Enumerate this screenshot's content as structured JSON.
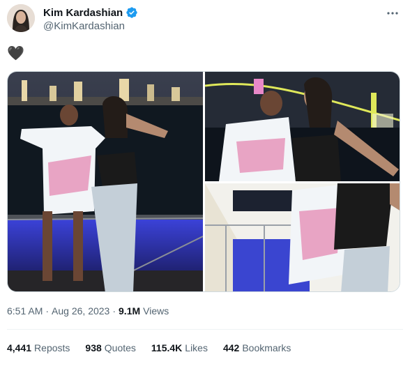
{
  "author": {
    "display_name": "Kim Kardashian",
    "handle": "@KimKardashian",
    "verified": true,
    "avatar_icon": "profile-photo",
    "verified_icon": "verified-badge-icon"
  },
  "tweet": {
    "text": "🖤"
  },
  "media": {
    "photo_count": 3
  },
  "meta": {
    "time": "6:51 AM",
    "separator": "·",
    "date": "Aug 26, 2023",
    "views_count": "9.1M",
    "views_label": "Views"
  },
  "stats": {
    "reposts_count": "4,441",
    "reposts_label": "Reposts",
    "quotes_count": "938",
    "quotes_label": "Quotes",
    "likes_count": "115.4K",
    "likes_label": "Likes",
    "bookmarks_count": "442",
    "bookmarks_label": "Bookmarks"
  },
  "colors": {
    "text_primary": "#0f1419",
    "text_secondary": "#536471",
    "verified_blue": "#1d9bf0",
    "border": "#cfd9de"
  }
}
